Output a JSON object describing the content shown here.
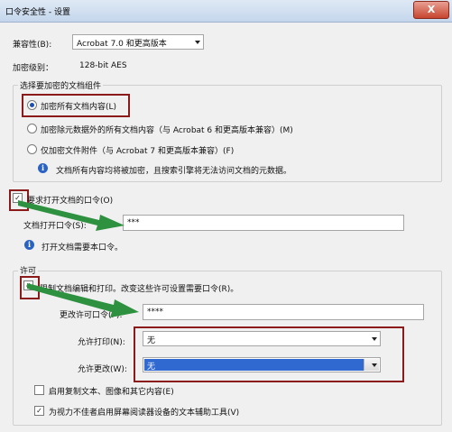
{
  "window": {
    "title": "口令安全性 - 设置",
    "close": "X"
  },
  "compat": {
    "label": "兼容性(B):",
    "value": "Acrobat 7.0 和更高版本"
  },
  "encryption_level": {
    "label": "加密级别：",
    "value": "128-bit AES"
  },
  "components": {
    "legend": "选择要加密的文档组件",
    "options": [
      "加密所有文档内容(L)",
      "加密除元数据外的所有文档内容（与 Acrobat 6 和更高版本兼容）(M)",
      "仅加密文件附件（与 Acrobat 7 和更高版本兼容）(F)"
    ],
    "info": "文档所有内容均将被加密，且搜索引擎将无法访问文档的元数据。"
  },
  "open_password": {
    "checkbox_label": "要求打开文档的口令(O)",
    "field_label": "文档打开口令(S):",
    "field_value": "***",
    "info": "打开文档需要本口令。"
  },
  "permissions": {
    "legend": "许可",
    "restrict_label": "限制文档编辑和打印。改变这些许可设置需要口令(R)。",
    "change_label": "更改许可口令(P):",
    "change_value": "****",
    "print_label": "允许打印(N):",
    "print_value": "无",
    "change_allowed_label": "允许更改(W):",
    "change_allowed_value": "无",
    "copy_label": "启用复制文本、图像和其它内容(E)",
    "reader_label": "为视力不佳者启用屏幕阅读器设备的文本辅助工具(V)"
  },
  "colors": {
    "highlight": "#8b1a1a",
    "arrow": "#2e9140",
    "selection": "#3069d0"
  }
}
